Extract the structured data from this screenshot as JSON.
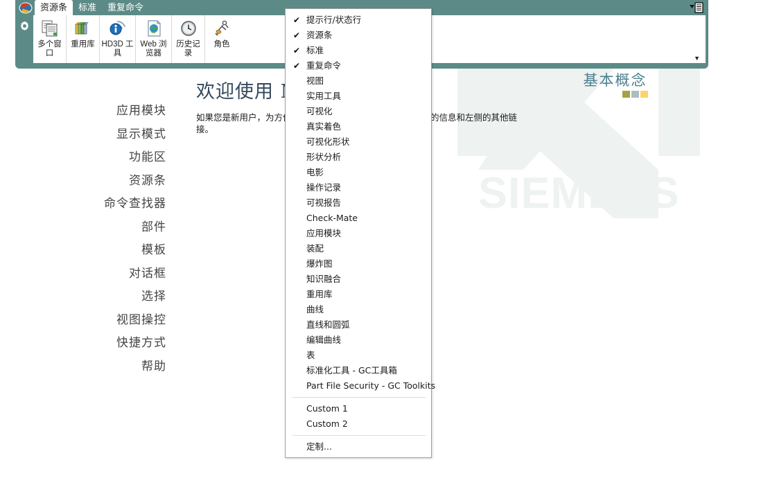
{
  "app": {
    "logo_icon": "nx-logo-icon",
    "gear_icon": "gear-icon",
    "minimize_icon": "minimize-ribbon-icon",
    "more_icon": "ribbon-overflow-icon"
  },
  "ribbon": {
    "tabs": [
      {
        "label": "资源条",
        "active": true
      },
      {
        "label": "标准",
        "active": false
      },
      {
        "label": "重复命令",
        "active": false
      }
    ],
    "buttons": [
      {
        "label": "多个窗口",
        "icon": "multiple-windows-icon"
      },
      {
        "label": "重用库",
        "icon": "reuse-library-icon"
      },
      {
        "label": "HD3D 工具",
        "icon": "hd3d-tools-icon"
      },
      {
        "label": "Web 浏览器",
        "icon": "web-browser-icon"
      },
      {
        "label": "历史记录",
        "icon": "history-clock-icon"
      },
      {
        "label": "角色",
        "icon": "roles-icon"
      }
    ]
  },
  "leftnav": {
    "items": [
      "应用模块",
      "显示模式",
      "功能区",
      "资源条",
      "命令查找器",
      "部件",
      "模板",
      "对话框",
      "选择",
      "视图操控",
      "快捷方式",
      "帮助"
    ]
  },
  "main": {
    "welcome_title": "欢迎使用 N",
    "welcome_body": "如果您是新用户，为方便您使用，请参阅右侧“基本概念”模块的信息和左侧的其他链接。"
  },
  "panel": {
    "title": "基本概念",
    "swatches": [
      "#a3a343",
      "#a8bfc2",
      "#fad46b"
    ]
  },
  "watermark": {
    "nx_text": "NX",
    "siemens_text": "SIEMENS",
    "color": "#eef2f1"
  },
  "menu": {
    "items": [
      {
        "label": "提示行/状态行",
        "checked": true
      },
      {
        "label": "资源条",
        "checked": true
      },
      {
        "label": "标准",
        "checked": true
      },
      {
        "label": "重复命令",
        "checked": true
      },
      {
        "label": "视图",
        "checked": false
      },
      {
        "label": "实用工具",
        "checked": false
      },
      {
        "label": "可视化",
        "checked": false
      },
      {
        "label": "真实着色",
        "checked": false
      },
      {
        "label": "可视化形状",
        "checked": false
      },
      {
        "label": "形状分析",
        "checked": false
      },
      {
        "label": "电影",
        "checked": false
      },
      {
        "label": "操作记录",
        "checked": false
      },
      {
        "label": "可视报告",
        "checked": false
      },
      {
        "label": "Check-Mate",
        "checked": false
      },
      {
        "label": "应用模块",
        "checked": false
      },
      {
        "label": "装配",
        "checked": false
      },
      {
        "label": "爆炸图",
        "checked": false
      },
      {
        "label": "知识融合",
        "checked": false
      },
      {
        "label": "重用库",
        "checked": false
      },
      {
        "label": "曲线",
        "checked": false
      },
      {
        "label": "直线和圆弧",
        "checked": false
      },
      {
        "label": "编辑曲线",
        "checked": false
      },
      {
        "label": "表",
        "checked": false
      },
      {
        "label": "标准化工具 - GC工具箱",
        "checked": false
      },
      {
        "label": "Part File Security - GC Toolkits",
        "checked": false
      },
      {
        "separator": true
      },
      {
        "label": "Custom 1",
        "checked": false
      },
      {
        "label": "Custom 2",
        "checked": false
      },
      {
        "separator": true
      },
      {
        "label": "定制...",
        "checked": false
      }
    ],
    "check_glyph": "✔"
  },
  "colors": {
    "ribbon_teal": "#5c8b87",
    "title_teal": "#4b7f8c",
    "heading_navy": "#34495e"
  }
}
